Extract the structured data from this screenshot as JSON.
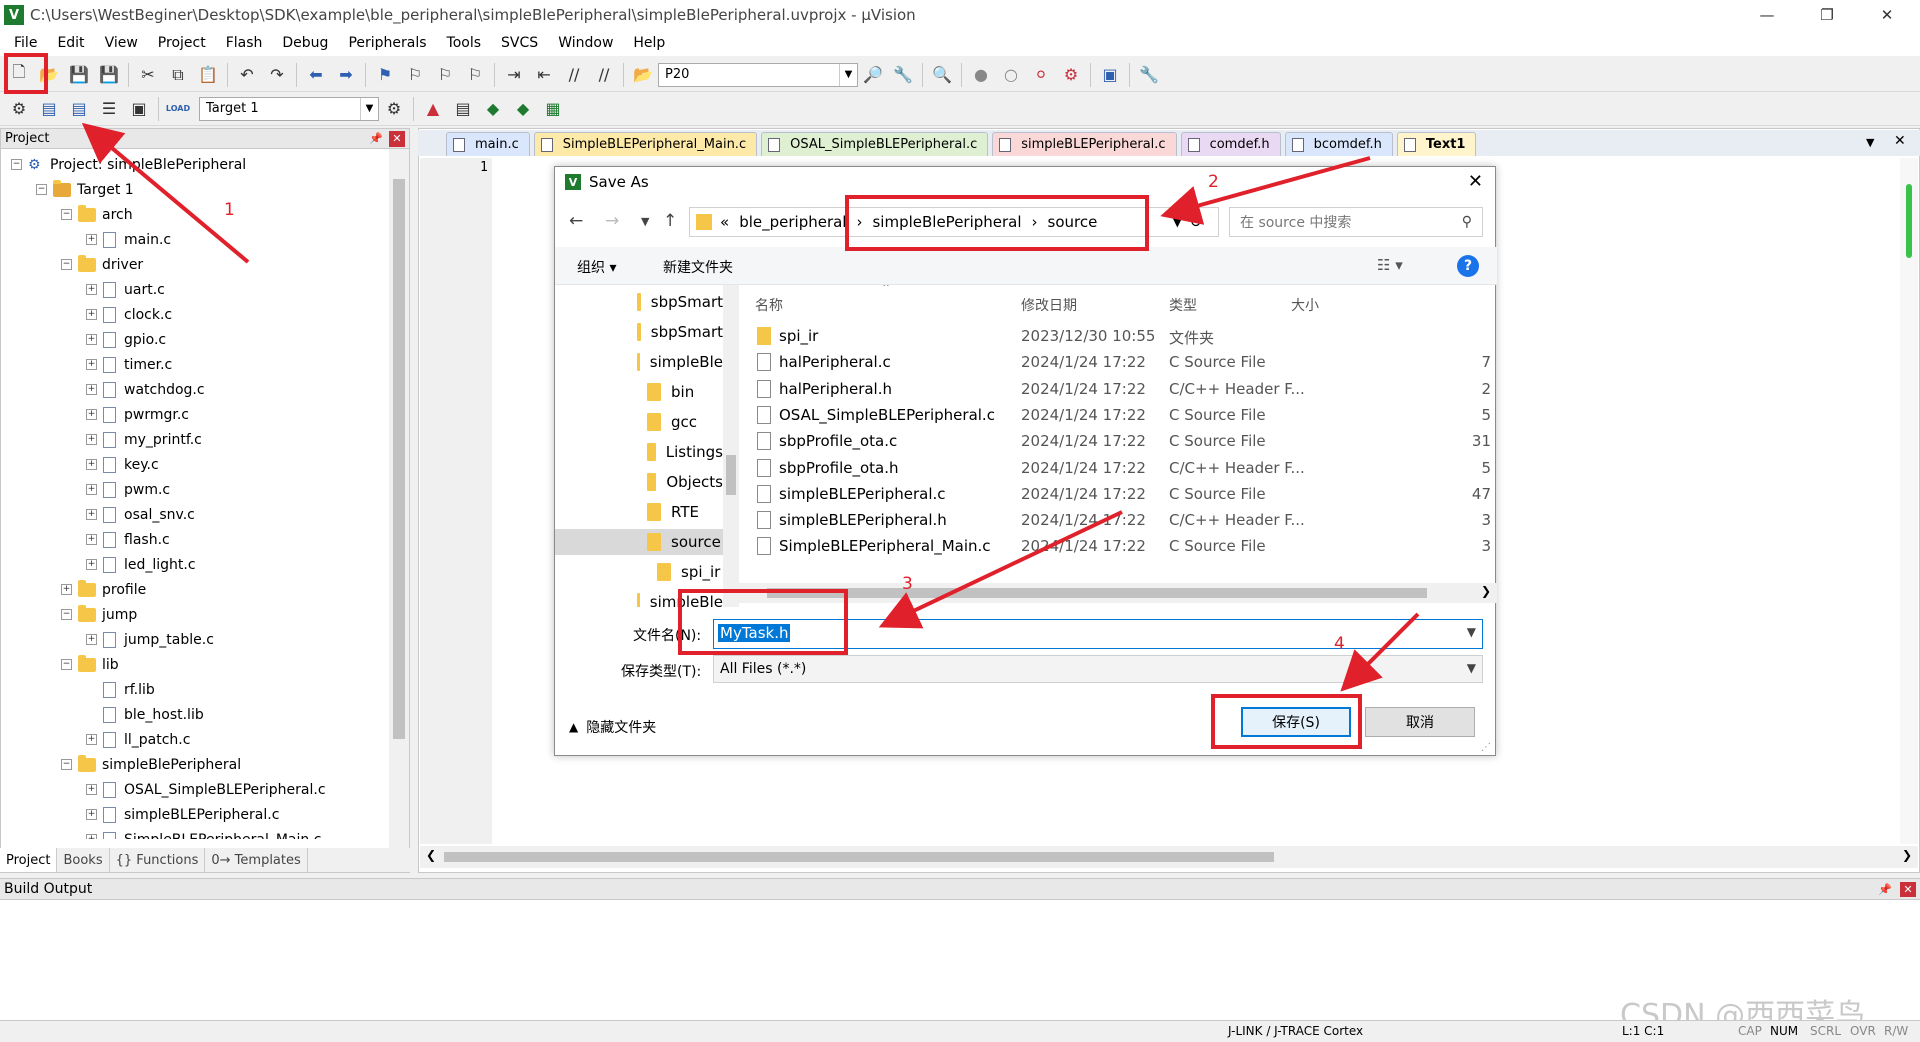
{
  "window": {
    "title": "C:\\Users\\WestBeginer\\Desktop\\SDK\\example\\ble_peripheral\\simpleBlePeripheral\\simpleBlePeripheral.uvprojx - µVision",
    "logo_letter": "V"
  },
  "menu": [
    "File",
    "Edit",
    "View",
    "Project",
    "Flash",
    "Debug",
    "Peripherals",
    "Tools",
    "SVCS",
    "Window",
    "Help"
  ],
  "toolbar": {
    "find_value": "P20",
    "target_value": "Target 1",
    "load_label": "LOAD"
  },
  "project_panel": {
    "title": "Project",
    "tree": [
      {
        "label": "Project: simpleBlePeripheral",
        "level": 0,
        "kind": "project",
        "expander": "⊟"
      },
      {
        "label": "Target 1",
        "level": 1,
        "kind": "target",
        "expander": "⊟"
      },
      {
        "label": "arch",
        "level": 2,
        "kind": "folder",
        "expander": "⊟"
      },
      {
        "label": "main.c",
        "level": 3,
        "kind": "file",
        "expander": "⊞"
      },
      {
        "label": "driver",
        "level": 2,
        "kind": "folder",
        "expander": "⊟"
      },
      {
        "label": "uart.c",
        "level": 3,
        "kind": "file",
        "expander": "⊞"
      },
      {
        "label": "clock.c",
        "level": 3,
        "kind": "file",
        "expander": "⊞"
      },
      {
        "label": "gpio.c",
        "level": 3,
        "kind": "file",
        "expander": "⊞"
      },
      {
        "label": "timer.c",
        "level": 3,
        "kind": "file",
        "expander": "⊞"
      },
      {
        "label": "watchdog.c",
        "level": 3,
        "kind": "file",
        "expander": "⊞"
      },
      {
        "label": "pwrmgr.c",
        "level": 3,
        "kind": "file",
        "expander": "⊞"
      },
      {
        "label": "my_printf.c",
        "level": 3,
        "kind": "file",
        "expander": "⊞"
      },
      {
        "label": "key.c",
        "level": 3,
        "kind": "file",
        "expander": "⊞"
      },
      {
        "label": "pwm.c",
        "level": 3,
        "kind": "file",
        "expander": "⊞"
      },
      {
        "label": "osal_snv.c",
        "level": 3,
        "kind": "file",
        "expander": "⊞"
      },
      {
        "label": "flash.c",
        "level": 3,
        "kind": "file",
        "expander": "⊞"
      },
      {
        "label": "led_light.c",
        "level": 3,
        "kind": "file",
        "expander": "⊞"
      },
      {
        "label": "profile",
        "level": 2,
        "kind": "folder",
        "expander": "⊞"
      },
      {
        "label": "jump",
        "level": 2,
        "kind": "folder",
        "expander": "⊟"
      },
      {
        "label": "jump_table.c",
        "level": 3,
        "kind": "file",
        "expander": "⊞"
      },
      {
        "label": "lib",
        "level": 2,
        "kind": "folder",
        "expander": "⊟"
      },
      {
        "label": "rf.lib",
        "level": 3,
        "kind": "file",
        "expander": ""
      },
      {
        "label": "ble_host.lib",
        "level": 3,
        "kind": "file",
        "expander": ""
      },
      {
        "label": "ll_patch.c",
        "level": 3,
        "kind": "file",
        "expander": "⊞"
      },
      {
        "label": "simpleBlePeripheral",
        "level": 2,
        "kind": "folder",
        "expander": "⊟"
      },
      {
        "label": "OSAL_SimpleBLEPeripheral.c",
        "level": 3,
        "kind": "file",
        "expander": "⊞"
      },
      {
        "label": "simpleBLEPeripheral.c",
        "level": 3,
        "kind": "file",
        "expander": "⊞"
      },
      {
        "label": "SimpleBLEPeripheral_Main.c",
        "level": 3,
        "kind": "file",
        "expander": "⊞"
      }
    ],
    "tabs": [
      "Project",
      "Books",
      "{} Functions",
      "0→ Templates"
    ]
  },
  "editor": {
    "tabs": [
      {
        "label": "main.c",
        "color": "#d9e6fb"
      },
      {
        "label": "SimpleBLEPeripheral_Main.c",
        "color": "#fde9a8"
      },
      {
        "label": "OSAL_SimpleBLEPeripheral.c",
        "color": "#dff0d2"
      },
      {
        "label": "simpleBLEPeripheral.c",
        "color": "#fbd8d8"
      },
      {
        "label": "comdef.h",
        "color": "#ead9f3"
      },
      {
        "label": "bcomdef.h",
        "color": "#d9e6fb"
      },
      {
        "label": "Text1",
        "color": "#fde9a8"
      }
    ],
    "line_number": "1"
  },
  "dialog": {
    "title": "Save As",
    "breadcrumb": [
      "«",
      "ble_peripheral",
      "›",
      "simpleBlePeripheral",
      "›",
      "source"
    ],
    "search_placeholder": "在 source 中搜索",
    "organize": "组织 ▾",
    "new_folder": "新建文件夹",
    "nav_items": [
      {
        "label": "sbpSmart",
        "indent": 0,
        "selected": false
      },
      {
        "label": "sbpSmart",
        "indent": 0,
        "selected": false
      },
      {
        "label": "simpleBle",
        "indent": 0,
        "selected": false
      },
      {
        "label": "bin",
        "indent": 1,
        "selected": false
      },
      {
        "label": "gcc",
        "indent": 1,
        "selected": false
      },
      {
        "label": "Listings",
        "indent": 1,
        "selected": false
      },
      {
        "label": "Objects",
        "indent": 1,
        "selected": false
      },
      {
        "label": "RTE",
        "indent": 1,
        "selected": false
      },
      {
        "label": "source",
        "indent": 1,
        "selected": true
      },
      {
        "label": "spi_ir",
        "indent": 2,
        "selected": false
      },
      {
        "label": "simpleBle",
        "indent": 0,
        "selected": false
      }
    ],
    "columns": [
      "名称",
      "修改日期",
      "类型",
      "大小"
    ],
    "files": [
      {
        "name": "spi_ir",
        "date": "2023/12/30 10:55",
        "type": "文件夹",
        "size": "",
        "folder": true
      },
      {
        "name": "halPeripheral.c",
        "date": "2024/1/24 17:22",
        "type": "C Source File",
        "size": "7",
        "folder": false
      },
      {
        "name": "halPeripheral.h",
        "date": "2024/1/24 17:22",
        "type": "C/C++ Header F...",
        "size": "2",
        "folder": false
      },
      {
        "name": "OSAL_SimpleBLEPeripheral.c",
        "date": "2024/1/24 17:22",
        "type": "C Source File",
        "size": "5",
        "folder": false
      },
      {
        "name": "sbpProfile_ota.c",
        "date": "2024/1/24 17:22",
        "type": "C Source File",
        "size": "31",
        "folder": false
      },
      {
        "name": "sbpProfile_ota.h",
        "date": "2024/1/24 17:22",
        "type": "C/C++ Header F...",
        "size": "5",
        "folder": false
      },
      {
        "name": "simpleBLEPeripheral.c",
        "date": "2024/1/24 17:22",
        "type": "C Source File",
        "size": "47",
        "folder": false
      },
      {
        "name": "simpleBLEPeripheral.h",
        "date": "2024/1/24 17:22",
        "type": "C/C++ Header F...",
        "size": "3",
        "folder": false
      },
      {
        "name": "SimpleBLEPeripheral_Main.c",
        "date": "2024/1/24 17:22",
        "type": "C Source File",
        "size": "3",
        "folder": false
      }
    ],
    "filename_label": "文件名(N):",
    "filename_value": "MyTask.h",
    "filetype_label": "保存类型(T):",
    "filetype_value": "All Files (*.*)",
    "hide_folders": "隐藏文件夹",
    "save_button": "保存(S)",
    "cancel_button": "取消"
  },
  "annotations": [
    "1",
    "2",
    "3",
    "4"
  ],
  "build_output": {
    "title": "Build Output"
  },
  "status": {
    "debugger": "J-LINK / J-TRACE Cortex",
    "position": "L:1 C:1",
    "indicators": [
      "CAP",
      "NUM",
      "SCRL",
      "OVR",
      "R/W"
    ]
  },
  "watermark": "CSDN @西西菜鸟",
  "colors": {
    "annotation_red": "#e0202a",
    "accent_blue": "#0078d7",
    "selection_blue": "#cce8ff"
  }
}
